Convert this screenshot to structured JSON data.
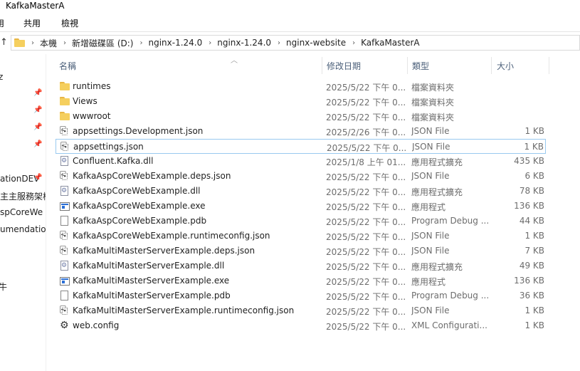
{
  "window": {
    "title": "KafkaMasterA"
  },
  "ribbon": {
    "tabs": [
      "用",
      "共用",
      "檢視"
    ]
  },
  "address": {
    "up_glyph": "↑",
    "breadcrumbs": [
      "本機",
      "新增磁碟區 (D:)",
      "nginx-1.24.0",
      "nginx-1.24.0",
      "nginx-website",
      "KafkaMasterA"
    ]
  },
  "nav": {
    "items": [
      {
        "label": "z",
        "pinned": false
      },
      {
        "label": "",
        "pinned": true
      },
      {
        "label": "",
        "pinned": true
      },
      {
        "label": "",
        "pinned": true
      },
      {
        "label": "",
        "pinned": true
      },
      {
        "label": "ationDEV",
        "pinned": true
      },
      {
        "label": "主主服務架構",
        "pinned": false
      },
      {
        "label": "spCoreWe",
        "pinned": false
      },
      {
        "label": "umendatio",
        "pinned": false
      },
      {
        "label": "牛",
        "pinned": false
      }
    ]
  },
  "columns": {
    "name": "名稱",
    "date": "修改日期",
    "type": "類型",
    "size": "大小"
  },
  "files": [
    {
      "name": "runtimes",
      "date": "2025/5/22 下午 0...",
      "type": "檔案資料夾",
      "size": "",
      "icon": "folder-icon"
    },
    {
      "name": "Views",
      "date": "2025/5/22 下午 0...",
      "type": "檔案資料夾",
      "size": "",
      "icon": "folder-icon"
    },
    {
      "name": "wwwroot",
      "date": "2025/5/22 下午 0...",
      "type": "檔案資料夾",
      "size": "",
      "icon": "folder-icon"
    },
    {
      "name": "appsettings.Development.json",
      "date": "2025/2/26 下午 0...",
      "type": "JSON File",
      "size": "1 KB",
      "icon": "json-file-icon"
    },
    {
      "name": "appsettings.json",
      "date": "2025/5/22 下午 0...",
      "type": "JSON File",
      "size": "1 KB",
      "icon": "json-file-icon",
      "selected": true
    },
    {
      "name": "Confluent.Kafka.dll",
      "date": "2025/1/8 上午 01...",
      "type": "應用程式擴充",
      "size": "435 KB",
      "icon": "dll-file-icon"
    },
    {
      "name": "KafkaAspCoreWebExample.deps.json",
      "date": "2025/5/22 下午 0...",
      "type": "JSON File",
      "size": "6 KB",
      "icon": "json-file-icon"
    },
    {
      "name": "KafkaAspCoreWebExample.dll",
      "date": "2025/5/22 下午 0...",
      "type": "應用程式擴充",
      "size": "78 KB",
      "icon": "dll-file-icon"
    },
    {
      "name": "KafkaAspCoreWebExample.exe",
      "date": "2025/5/22 下午 0...",
      "type": "應用程式",
      "size": "136 KB",
      "icon": "exe-file-icon"
    },
    {
      "name": "KafkaAspCoreWebExample.pdb",
      "date": "2025/5/22 下午 0...",
      "type": "Program Debug ...",
      "size": "44 KB",
      "icon": "pdb-file-icon"
    },
    {
      "name": "KafkaAspCoreWebExample.runtimeconfig.json",
      "date": "2025/5/22 下午 0...",
      "type": "JSON File",
      "size": "1 KB",
      "icon": "json-file-icon"
    },
    {
      "name": "KafkaMultiMasterServerExample.deps.json",
      "date": "2025/5/22 下午 0...",
      "type": "JSON File",
      "size": "7 KB",
      "icon": "json-file-icon"
    },
    {
      "name": "KafkaMultiMasterServerExample.dll",
      "date": "2025/5/22 下午 0...",
      "type": "應用程式擴充",
      "size": "49 KB",
      "icon": "dll-file-icon"
    },
    {
      "name": "KafkaMultiMasterServerExample.exe",
      "date": "2025/5/22 下午 0...",
      "type": "應用程式",
      "size": "136 KB",
      "icon": "exe-file-icon"
    },
    {
      "name": "KafkaMultiMasterServerExample.pdb",
      "date": "2025/5/22 下午 0...",
      "type": "Program Debug ...",
      "size": "36 KB",
      "icon": "pdb-file-icon"
    },
    {
      "name": "KafkaMultiMasterServerExample.runtimeconfig.json",
      "date": "2025/5/22 下午 0...",
      "type": "JSON File",
      "size": "1 KB",
      "icon": "json-file-icon"
    },
    {
      "name": "web.config",
      "date": "2025/5/22 下午 0...",
      "type": "XML Configurati...",
      "size": "1 KB",
      "icon": "config-file-icon"
    }
  ]
}
